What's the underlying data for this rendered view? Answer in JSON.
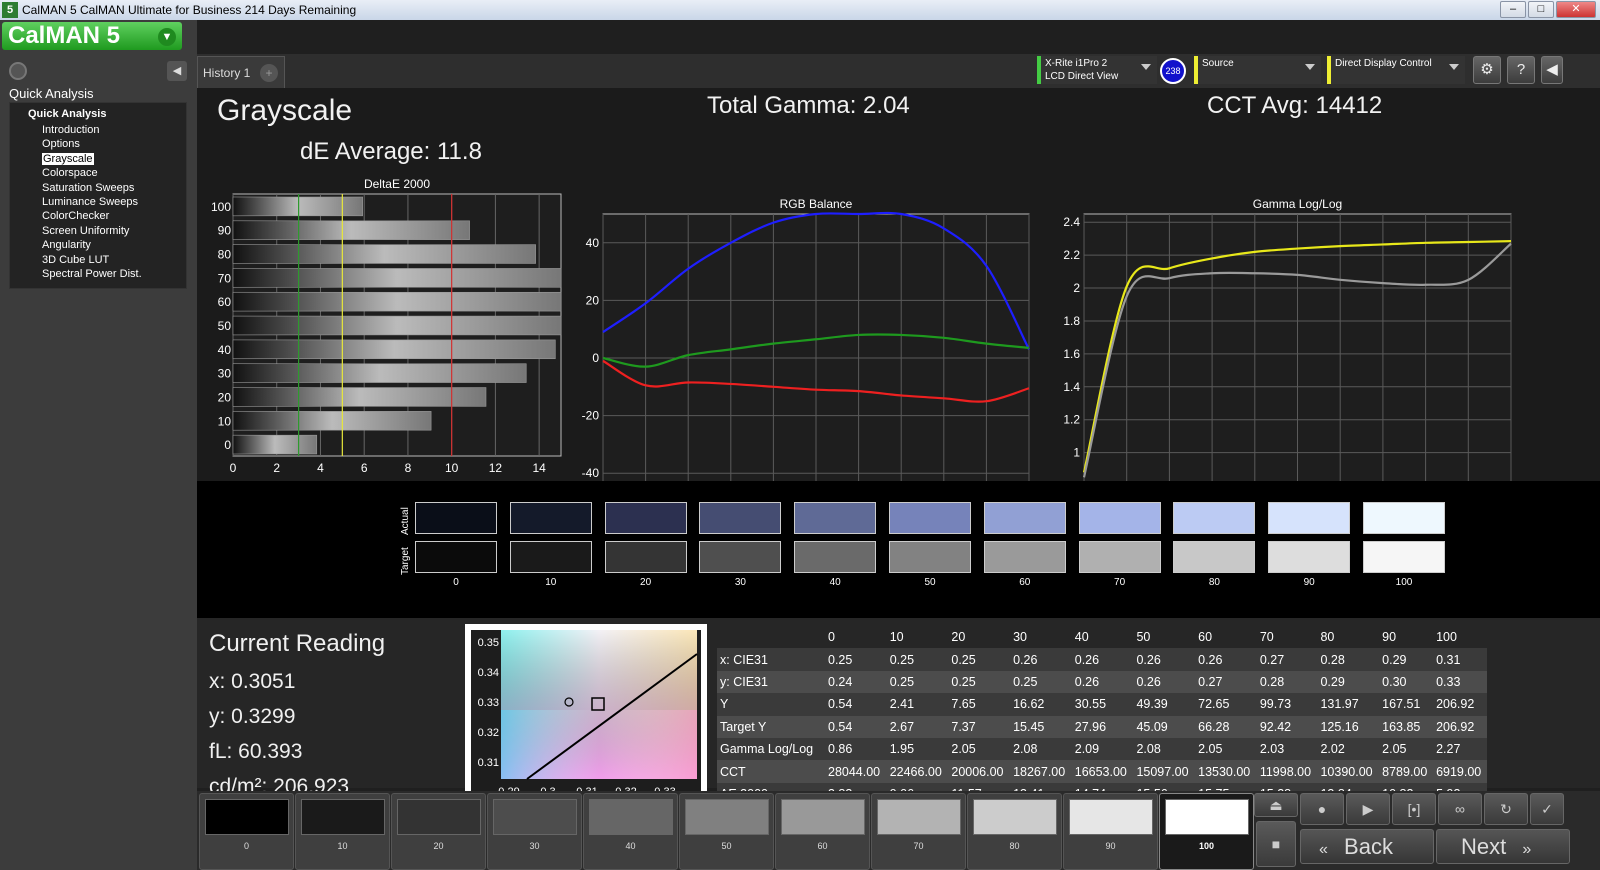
{
  "window": {
    "app_icon": "5",
    "title": "CalMAN 5 CalMAN Ultimate for Business 214 Days Remaining",
    "buttons": [
      "minimize-icon",
      "maximize-icon",
      "close-icon"
    ]
  },
  "sidebar": {
    "logo": "CalMAN 5",
    "section_label": "Quick Analysis",
    "tree_root": "Quick Analysis",
    "items": [
      {
        "label": "Introduction",
        "selected": false
      },
      {
        "label": "Options",
        "selected": false
      },
      {
        "label": "Grayscale",
        "selected": true
      },
      {
        "label": "Colorspace",
        "selected": false
      },
      {
        "label": "Saturation Sweeps",
        "selected": false
      },
      {
        "label": "Luminance Sweeps",
        "selected": false
      },
      {
        "label": "ColorChecker",
        "selected": false
      },
      {
        "label": "Screen Uniformity",
        "selected": false
      },
      {
        "label": "Angularity",
        "selected": false
      },
      {
        "label": "3D Cube LUT",
        "selected": false
      },
      {
        "label": "Spectral Power Dist.",
        "selected": false
      }
    ]
  },
  "tabs": {
    "history": "History 1",
    "add": "+"
  },
  "devices": {
    "meter_line1": "X-Rite i1Pro 2",
    "meter_line2": "LCD Direct View",
    "badge": "238",
    "source": "Source",
    "display": "Direct Display Control"
  },
  "headings": {
    "page_title": "Grayscale",
    "de_average": "dE Average: 11.8",
    "total_gamma": "Total Gamma: 2.04",
    "cct_avg": "CCT Avg: 14412"
  },
  "chart_data": [
    {
      "type": "bar",
      "title": "DeltaE 2000",
      "categories": [
        "0",
        "10",
        "20",
        "30",
        "40",
        "50",
        "60",
        "70",
        "80",
        "90",
        "100"
      ],
      "values": [
        3.83,
        9.06,
        11.57,
        13.41,
        14.74,
        15.56,
        15.75,
        15.28,
        13.84,
        10.82,
        5.93
      ],
      "xlim": [
        0,
        15
      ],
      "xticks": [
        0,
        2,
        4,
        6,
        8,
        10,
        12,
        14
      ],
      "reference_lines": [
        {
          "x": 3,
          "color": "#2e9a2e"
        },
        {
          "x": 5,
          "color": "#e8e83a"
        },
        {
          "x": 10,
          "color": "#d23030"
        }
      ]
    },
    {
      "type": "line",
      "title": "RGB Balance",
      "x": [
        0,
        10,
        20,
        30,
        40,
        50,
        60,
        70,
        80,
        90,
        100
      ],
      "ylim": [
        -50,
        50
      ],
      "yticks": [
        -40,
        -20,
        0,
        20,
        40
      ],
      "series": [
        {
          "color": "#1e1eff",
          "values": [
            9,
            19,
            31,
            40,
            47,
            50,
            50,
            50,
            45,
            32,
            3
          ]
        },
        {
          "color": "#1e9a1e",
          "values": [
            0,
            -3,
            1,
            3,
            5,
            6.5,
            8,
            8,
            7,
            5,
            3.5
          ]
        },
        {
          "color": "#ee2020",
          "values": [
            -1,
            -9.5,
            -8.5,
            -9,
            -10,
            -11,
            -11.5,
            -13,
            -14,
            -15,
            -10.5
          ]
        }
      ]
    },
    {
      "type": "line",
      "title": "Gamma Log/Log",
      "x": [
        0,
        10,
        20,
        30,
        40,
        50,
        60,
        70,
        80,
        90,
        100
      ],
      "ylim": [
        0.7,
        2.45
      ],
      "yticks": [
        0.8,
        1,
        1.2,
        1.4,
        1.6,
        1.8,
        2,
        2.2,
        2.4
      ],
      "series": [
        {
          "color": "#e8e81a",
          "values": [
            0.88,
            2.01,
            2.12,
            2.18,
            2.22,
            2.24,
            2.255,
            2.265,
            2.275,
            2.28,
            2.285
          ]
        },
        {
          "color": "#9a9a9a",
          "values": [
            0.85,
            1.95,
            2.06,
            2.09,
            2.09,
            2.08,
            2.05,
            2.03,
            2.02,
            2.05,
            2.27
          ]
        }
      ]
    }
  ],
  "swatches": {
    "row_labels": [
      "Actual",
      "Target"
    ],
    "levels": [
      "0",
      "10",
      "20",
      "30",
      "40",
      "50",
      "60",
      "70",
      "80",
      "90",
      "100"
    ],
    "actual_colors": [
      "#0a0e18",
      "#141a2a",
      "#2c3050",
      "#454d72",
      "#5f6a96",
      "#7683ba",
      "#91a0d4",
      "#a4b4e8",
      "#bccbf3",
      "#d6e3fc",
      "#eef8fe"
    ],
    "target_colors": [
      "#0b0b0b",
      "#1a1a1a",
      "#343434",
      "#4f4f4f",
      "#6a6a6a",
      "#828282",
      "#9a9a9a",
      "#b0b0b0",
      "#c8c8c8",
      "#dddddd",
      "#f6f6f6"
    ]
  },
  "reading": {
    "title": "Current Reading",
    "x": "x: 0.3051",
    "y": "y: 0.3299",
    "fl": "fL: 60.393",
    "cdm2": "cd/m²: 206.923"
  },
  "cie": {
    "xticks": [
      "0.29",
      "0.3",
      "0.31",
      "0.32",
      "0.33"
    ],
    "yticks": [
      "0.35",
      "0.34",
      "0.33",
      "0.32",
      "0.31"
    ]
  },
  "table": {
    "columns": [
      "0",
      "10",
      "20",
      "30",
      "40",
      "50",
      "60",
      "70",
      "80",
      "90",
      "100"
    ],
    "rows": [
      {
        "label": "x: CIE31",
        "values": [
          "0.25",
          "0.25",
          "0.25",
          "0.26",
          "0.26",
          "0.26",
          "0.26",
          "0.27",
          "0.28",
          "0.29",
          "0.31"
        ]
      },
      {
        "label": "y: CIE31",
        "values": [
          "0.24",
          "0.25",
          "0.25",
          "0.25",
          "0.26",
          "0.26",
          "0.27",
          "0.28",
          "0.29",
          "0.30",
          "0.33"
        ]
      },
      {
        "label": "Y",
        "values": [
          "0.54",
          "2.41",
          "7.65",
          "16.62",
          "30.55",
          "49.39",
          "72.65",
          "99.73",
          "131.97",
          "167.51",
          "206.92"
        ]
      },
      {
        "label": "Target Y",
        "values": [
          "0.54",
          "2.67",
          "7.37",
          "15.45",
          "27.96",
          "45.09",
          "66.28",
          "92.42",
          "125.16",
          "163.85",
          "206.92"
        ]
      },
      {
        "label": "Gamma Log/Log",
        "values": [
          "0.86",
          "1.95",
          "2.05",
          "2.08",
          "2.09",
          "2.08",
          "2.05",
          "2.03",
          "2.02",
          "2.05",
          "2.27"
        ]
      },
      {
        "label": "CCT",
        "values": [
          "28044.00",
          "22466.00",
          "20006.00",
          "18267.00",
          "16653.00",
          "15097.00",
          "13530.00",
          "11998.00",
          "10390.00",
          "8789.00",
          "6919.00"
        ]
      },
      {
        "label": "ΔE 2000",
        "values": [
          "3.83",
          "9.06",
          "11.57",
          "13.41",
          "14.74",
          "15.56",
          "15.75",
          "15.28",
          "13.84",
          "10.82",
          "5.93"
        ]
      }
    ]
  },
  "bottom": {
    "levels": [
      "0",
      "10",
      "20",
      "30",
      "40",
      "50",
      "60",
      "70",
      "80",
      "90",
      "100"
    ],
    "colors": [
      "#000000",
      "#1a1a1a",
      "#333333",
      "#4d4d4d",
      "#666666",
      "#808080",
      "#999999",
      "#b3b3b3",
      "#cccccc",
      "#e6e6e6",
      "#ffffff"
    ],
    "selected": "100",
    "back": "Back",
    "next": "Next"
  }
}
